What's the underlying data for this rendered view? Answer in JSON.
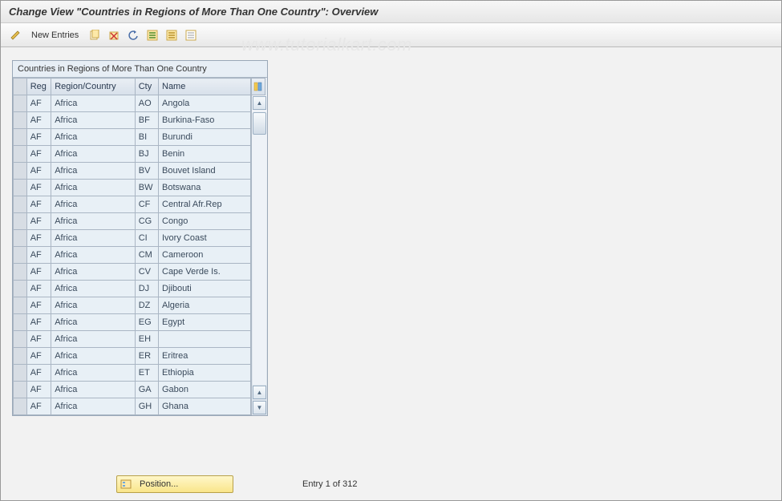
{
  "title": "Change View \"Countries in Regions of More Than One Country\": Overview",
  "toolbar": {
    "new_entries_label": "New Entries"
  },
  "watermark": "www.tutorialkart.com",
  "table": {
    "title": "Countries in Regions of More Than One Country",
    "headers": {
      "reg": "Reg",
      "region": "Region/Country",
      "cty": "Cty",
      "name": "Name"
    },
    "rows": [
      {
        "reg": "AF",
        "region": "Africa",
        "cty": "AO",
        "name": "Angola"
      },
      {
        "reg": "AF",
        "region": "Africa",
        "cty": "BF",
        "name": "Burkina-Faso"
      },
      {
        "reg": "AF",
        "region": "Africa",
        "cty": "BI",
        "name": "Burundi"
      },
      {
        "reg": "AF",
        "region": "Africa",
        "cty": "BJ",
        "name": "Benin"
      },
      {
        "reg": "AF",
        "region": "Africa",
        "cty": "BV",
        "name": "Bouvet Island"
      },
      {
        "reg": "AF",
        "region": "Africa",
        "cty": "BW",
        "name": "Botswana"
      },
      {
        "reg": "AF",
        "region": "Africa",
        "cty": "CF",
        "name": "Central Afr.Rep"
      },
      {
        "reg": "AF",
        "region": "Africa",
        "cty": "CG",
        "name": "Congo"
      },
      {
        "reg": "AF",
        "region": "Africa",
        "cty": "CI",
        "name": "Ivory Coast"
      },
      {
        "reg": "AF",
        "region": "Africa",
        "cty": "CM",
        "name": "Cameroon"
      },
      {
        "reg": "AF",
        "region": "Africa",
        "cty": "CV",
        "name": "Cape Verde Is."
      },
      {
        "reg": "AF",
        "region": "Africa",
        "cty": "DJ",
        "name": "Djibouti"
      },
      {
        "reg": "AF",
        "region": "Africa",
        "cty": "DZ",
        "name": "Algeria"
      },
      {
        "reg": "AF",
        "region": "Africa",
        "cty": "EG",
        "name": "Egypt"
      },
      {
        "reg": "AF",
        "region": "Africa",
        "cty": "EH",
        "name": ""
      },
      {
        "reg": "AF",
        "region": "Africa",
        "cty": "ER",
        "name": "Eritrea"
      },
      {
        "reg": "AF",
        "region": "Africa",
        "cty": "ET",
        "name": "Ethiopia"
      },
      {
        "reg": "AF",
        "region": "Africa",
        "cty": "GA",
        "name": "Gabon"
      },
      {
        "reg": "AF",
        "region": "Africa",
        "cty": "GH",
        "name": "Ghana"
      }
    ]
  },
  "footer": {
    "position_label": "Position...",
    "entry_text": "Entry 1 of 312"
  }
}
